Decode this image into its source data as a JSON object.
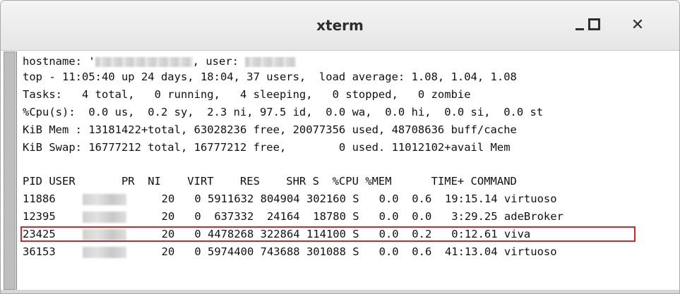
{
  "window": {
    "title": "xterm",
    "minimize_label": "minimize",
    "maximize_label": "maximize",
    "close_label": "close",
    "close_glyph": "✕"
  },
  "terminal": {
    "line_hostname_prefix": "hostname: '",
    "line_hostname_mid": ", user: ",
    "line_top": "top - 11:05:40 up 24 days, 18:04, 37 users,  load average: 1.08, 1.04, 1.08",
    "line_tasks": "Tasks:   4 total,   0 running,   4 sleeping,   0 stopped,   0 zombie",
    "line_cpu": "%Cpu(s):  0.0 us,  0.2 sy,  2.3 ni, 97.5 id,  0.0 wa,  0.0 hi,  0.0 si,  0.0 st",
    "line_mem": "KiB Mem : 13181422+total, 63028236 free, 20077356 used, 48708636 buff/cache",
    "line_swap": "KiB Swap: 16777212 total, 16777212 free,        0 used. 11012102+avail Mem",
    "header": "PID USER       PR  NI    VIRT    RES    SHR S  %CPU %MEM      TIME+ COMMAND",
    "processes": [
      {
        "pid": "11886",
        "rest": "20   0 5911632 804904 302160 S   0.0  0.6  19:15.14 virtuoso"
      },
      {
        "pid": "12395",
        "rest": "20   0  637332  24164  18780 S   0.0  0.0   3:29.25 adeBroker"
      },
      {
        "pid": "23425",
        "rest": "20   0 4478268 322864 114100 S   0.0  0.2   0:12.61 viva"
      },
      {
        "pid": "36153",
        "rest": "20   0 5974400 743688 301088 S   0.0  0.6  41:13.04 virtuoso"
      }
    ]
  }
}
